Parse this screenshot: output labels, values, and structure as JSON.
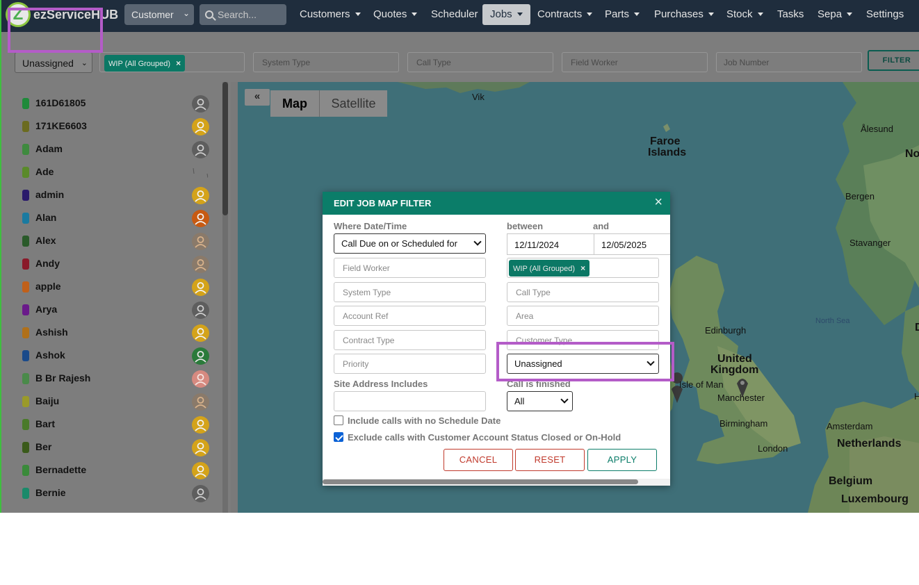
{
  "navbar": {
    "brand": "ezServiceHUB",
    "brand_initial": "Z",
    "entity_select": "Customer",
    "search_placeholder": "Search...",
    "menu": [
      {
        "label": "Customers",
        "dropdown": true
      },
      {
        "label": "Quotes",
        "dropdown": true
      },
      {
        "label": "Scheduler",
        "dropdown": false
      },
      {
        "label": "Jobs",
        "dropdown": true,
        "active": true
      },
      {
        "label": "Contracts",
        "dropdown": true
      },
      {
        "label": "Parts",
        "dropdown": true
      },
      {
        "label": "Purchases",
        "dropdown": true
      },
      {
        "label": "Stock",
        "dropdown": true
      },
      {
        "label": "Tasks",
        "dropdown": false
      },
      {
        "label": "Sepa",
        "dropdown": true
      },
      {
        "label": "Settings",
        "dropdown": false
      }
    ]
  },
  "filterbar": {
    "assignment": "Unassigned",
    "status_chip": "WIP (All Grouped)",
    "system_type_placeholder": "System Type",
    "call_type_placeholder": "Call Type",
    "field_worker_placeholder": "Field Worker",
    "job_number_placeholder": "Job Number",
    "filter_button": "FILTER"
  },
  "workers": [
    {
      "name": "161D61805",
      "color": "#1f8a3a",
      "avatar": "default"
    },
    {
      "name": "171KE6603",
      "color": "#6b6b1f",
      "avatar": "yellow"
    },
    {
      "name": "Adam",
      "color": "#3f8a3f",
      "avatar": "default"
    },
    {
      "name": "Ade",
      "color": "#5a8a2a",
      "avatar": "blank"
    },
    {
      "name": "admin",
      "color": "#2a1a6b",
      "avatar": "yellow"
    },
    {
      "name": "Alan",
      "color": "#1a7aa0",
      "avatar": "orange"
    },
    {
      "name": "Alex",
      "color": "#2a5a2a",
      "avatar": "photo"
    },
    {
      "name": "Andy",
      "color": "#8a1a2a",
      "avatar": "photo"
    },
    {
      "name": "apple",
      "color": "#c0601a",
      "avatar": "yellow"
    },
    {
      "name": "Arya",
      "color": "#6a1a8a",
      "avatar": "default"
    },
    {
      "name": "Ashish",
      "color": "#b0701a",
      "avatar": "yellow"
    },
    {
      "name": "Ashok",
      "color": "#1a4a8a",
      "avatar": "logo"
    },
    {
      "name": "B Br Rajesh",
      "color": "#4a8a4a",
      "avatar": "pink"
    },
    {
      "name": "Baiju",
      "color": "#9a9a2a",
      "avatar": "photo"
    },
    {
      "name": "Bart",
      "color": "#4a7a2a",
      "avatar": "yellow"
    },
    {
      "name": "Ber",
      "color": "#3a5a1a",
      "avatar": "yellow"
    },
    {
      "name": "Bernadette",
      "color": "#3a8a3a",
      "avatar": "yellow"
    },
    {
      "name": "Bernie",
      "color": "#1a8a6a",
      "avatar": "default"
    }
  ],
  "map": {
    "collapse_label": "«",
    "type_map": "Map",
    "type_satellite": "Satellite",
    "places": [
      {
        "label": "Vik",
        "cls": ""
      },
      {
        "label": "Faroe",
        "cls": "big"
      },
      {
        "label": "Islands",
        "cls": "big"
      },
      {
        "label": "Ålesund",
        "cls": ""
      },
      {
        "label": "No",
        "cls": "big"
      },
      {
        "label": "Bergen",
        "cls": ""
      },
      {
        "label": "Stavanger",
        "cls": ""
      },
      {
        "label": "North Sea",
        "cls": "sea"
      },
      {
        "label": "Edinburgh",
        "cls": ""
      },
      {
        "label": "United",
        "cls": "big"
      },
      {
        "label": "Kingdom",
        "cls": "big"
      },
      {
        "label": "Isle of Man",
        "cls": ""
      },
      {
        "label": "Manchester",
        "cls": ""
      },
      {
        "label": "Birmingham",
        "cls": ""
      },
      {
        "label": "London",
        "cls": ""
      },
      {
        "label": "Amsterdam",
        "cls": ""
      },
      {
        "label": "Netherlands",
        "cls": "big"
      },
      {
        "label": "Belgium",
        "cls": "big"
      },
      {
        "label": "Luxembourg",
        "cls": "big"
      },
      {
        "label": "H",
        "cls": ""
      },
      {
        "label": "D",
        "cls": "big"
      }
    ]
  },
  "modal": {
    "title": "EDIT JOB MAP FILTER",
    "close": "×",
    "where_label": "Where Date/Time",
    "between_label": "between",
    "and_label": "and",
    "date_type": "Call Due on or Scheduled for",
    "date_from": "12/11/2024",
    "date_to": "12/05/2025",
    "field_worker_placeholder": "Field Worker",
    "status_chip": "WIP (All Grouped)",
    "system_type_placeholder": "System Type",
    "call_type_placeholder": "Call Type",
    "account_ref_placeholder": "Account Ref",
    "area_placeholder": "Area",
    "contract_type_placeholder": "Contract Type",
    "customer_type_placeholder": "Customer Type",
    "priority_placeholder": "Priority",
    "assignment": "Unassigned",
    "site_address_label": "Site Address Includes",
    "site_address_value": "",
    "call_finished_label": "Call is finished",
    "call_finished_value": "All",
    "include_no_schedule_label": "Include calls with no Schedule Date",
    "include_no_schedule_checked": false,
    "exclude_closed_label": "Exclude calls with Customer Account Status Closed or On-Hold",
    "exclude_closed_checked": true,
    "cancel": "CANCEL",
    "reset": "RESET",
    "apply": "APPLY"
  },
  "colors": {
    "brand": "#0b7d69",
    "highlight": "#b45cc8",
    "danger": "#c0392b"
  }
}
